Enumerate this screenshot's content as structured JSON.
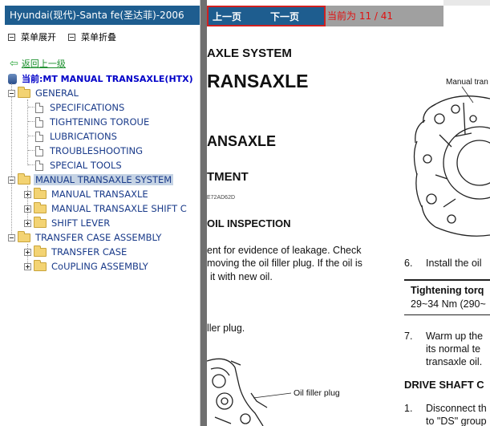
{
  "app": {
    "title": "Hyundai(现代)-Santa fe(圣达菲)-2006"
  },
  "toolbar": {
    "expand_label": "菜单展开",
    "collapse_label": "菜单折叠"
  },
  "tree": {
    "back_label": "返回上一级",
    "current_path": "当前:MT MANUAL TRANSAXLE(HTX)",
    "general": {
      "label": "GENERAL",
      "children": [
        "SPECIFICATIONS",
        "TIGHTENING TOROUE",
        "LUBRICATIONS",
        "TROUBLESHOOTING",
        "SPECIAL TOOLS"
      ]
    },
    "manual_system": {
      "label": "MANUAL TRANSAXLE SYSTEM",
      "children": [
        "MANUAL TRANSAXLE",
        "MANUAL TRANSAXLE SHIFT C",
        "SHIFT LEVER"
      ]
    },
    "transfer_case": {
      "label": "TRANSFER CASE ASSEMBLY",
      "children": [
        "TRANSFER CASE",
        "CoUPLING ASSEMBLY"
      ]
    }
  },
  "nav": {
    "prev_label": "上一页",
    "next_label": "下一页",
    "page_indicator": "当前为 11 / 41"
  },
  "document": {
    "system_heading": "AXLE SYSTEM",
    "transaxle_heading": "RANSAXLE",
    "transaxle_heading2": "ANSAXLE",
    "adjust_heading": "TMENT",
    "doc_code": "E72AD62D",
    "oil_heading": "OIL INSPECTION",
    "check_line1": "ent for evidence of leakage.  Check",
    "check_line2": "moving the oil filler plug. If the oil is",
    "check_line3": "it with new oil.",
    "filler_plug_line": "ller plug.",
    "label_manual_trans": "Manual tran",
    "label_oil_filler": "Oil filler plug",
    "step6_num": "6.",
    "step6_text": "Install the oil",
    "torque_title": "Tightening torq",
    "torque_value": "29~34 Nm (290~",
    "step7_num": "7.",
    "step7_line1": "Warm up the",
    "step7_line2": "its  normal  te",
    "step7_line3": "transaxle oil.",
    "drive_heading": "DRIVE SHAFT C",
    "step1_num": "1.",
    "step1_line1": "Disconnect th",
    "step1_line2": "to \"DS\" group"
  },
  "colors": {
    "title_bar": "#1e5d8f",
    "nav_outline": "#d02020",
    "page_indicator": "#e01010",
    "tree_text": "#1a3b8a",
    "current_path": "#0000c8",
    "selected_bg": "#c5d3e4"
  }
}
